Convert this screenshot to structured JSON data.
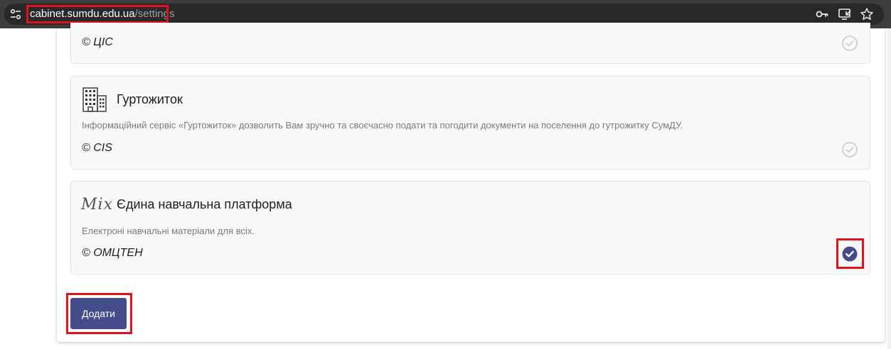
{
  "browser": {
    "url_host": "cabinet.sumdu.edu.ua",
    "url_path": "/settings",
    "icons": [
      "site-settings-icon",
      "key-icon",
      "install-app-icon",
      "star-icon"
    ]
  },
  "cards": [
    {
      "title": "",
      "description": "",
      "copyright": "© ЦІС",
      "selected": false
    },
    {
      "title": "Гуртожиток",
      "description": "Інформаційний сервіс «Гуртожиток» дозволить Вам зручно та своєчасно подати та погодити документи на поселення до гутрожитку СумДУ.",
      "copyright": "© CIS",
      "icon": "building-icon",
      "selected": false
    },
    {
      "title": "Єдина навчальна платформа",
      "description": "Електроні навчальні матеріали для всіх.",
      "copyright": "© ОМЦТЕН",
      "icon": "mix-logo",
      "logo_text": "Mix",
      "selected": true
    }
  ],
  "actions": {
    "add_label": "Додати"
  },
  "colors": {
    "accent": "#454c8b",
    "highlight": "#e0141e",
    "check_inactive": "#cfcfcf"
  }
}
